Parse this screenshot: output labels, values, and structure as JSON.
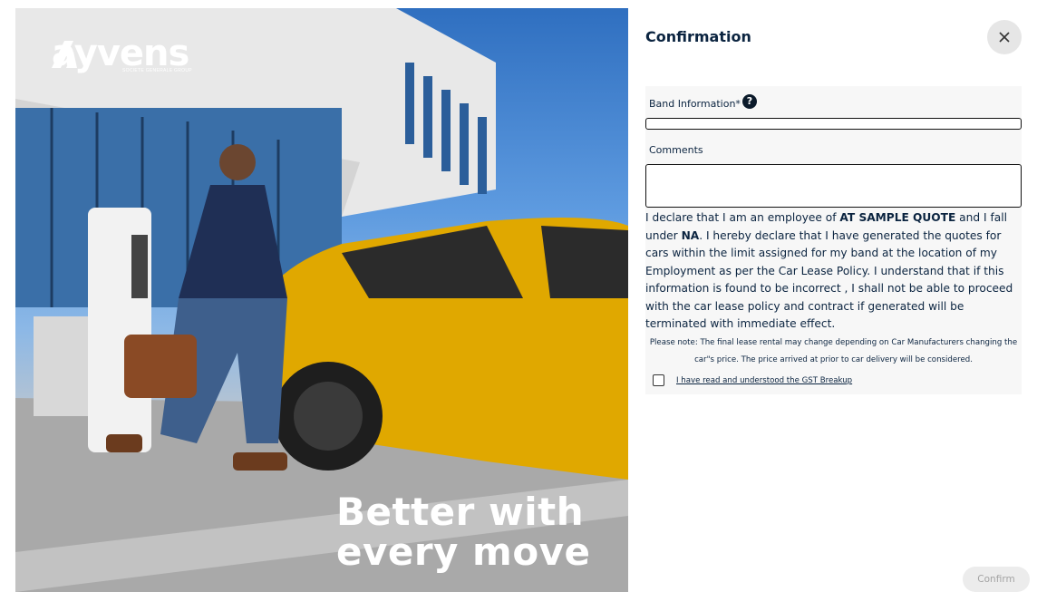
{
  "brand": {
    "name": "ayvens",
    "subtitle": "SOCIETE GENERALE GROUP",
    "tagline_line1": "Better with",
    "tagline_line2": "every move"
  },
  "dialog": {
    "title": "Confirmation",
    "close_icon": "close-icon",
    "band_label": "Band Information*",
    "band_value": "",
    "comments_label": "Comments",
    "comments_value": "",
    "declaration": {
      "part1": "I declare that I am an employee of ",
      "company": "AT SAMPLE QUOTE",
      "part2": " and I fall under ",
      "band": "NA",
      "part3": ". I hereby declare that I have generated the quotes for cars within the limit assigned for my band at the location of my Employment as per the Car Lease Policy. I understand that if this information is found to be incorrect , I shall not be able to proceed with the car lease policy and contract if generated will be terminated with immediate effect."
    },
    "note": "Please note: The final lease rental may change depending on Car Manufacturers changing the car\"s price. The price arrived at prior to car delivery will be considered.",
    "checkbox_label": "I have read and understood the GST Breakup",
    "checkbox_checked": false,
    "confirm_label": "Confirm"
  },
  "colors": {
    "navy": "#0b2440",
    "confirm_bg": "#ececec",
    "confirm_text": "#a4a4a4",
    "car": "#e0a800"
  }
}
